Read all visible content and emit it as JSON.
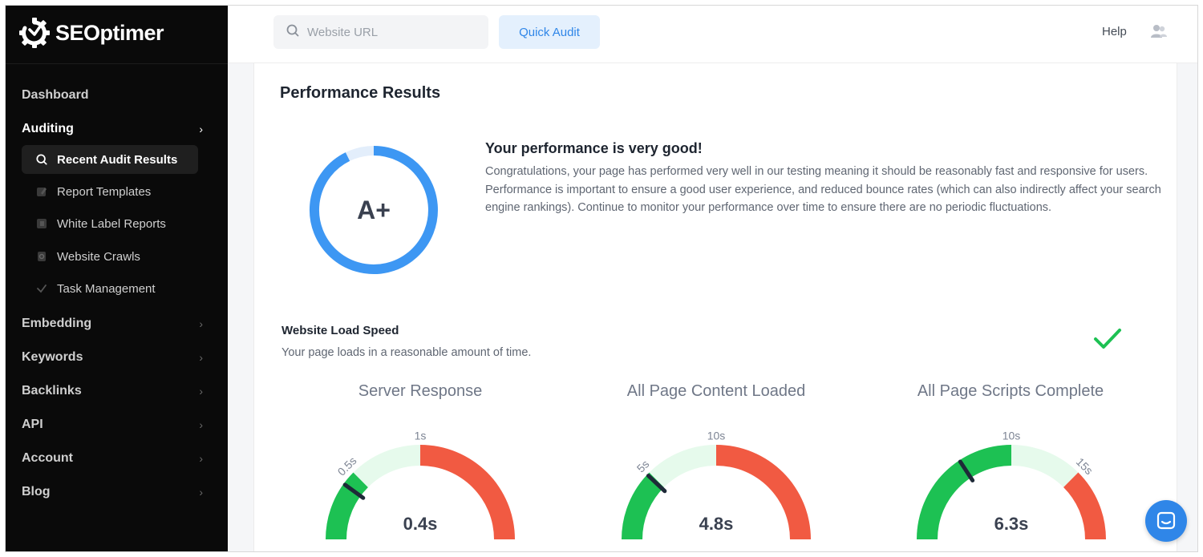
{
  "brand": {
    "name": "SEOptimer"
  },
  "sidebar": {
    "items": [
      {
        "label": "Dashboard"
      },
      {
        "label": "Auditing",
        "expanded": true
      },
      {
        "label": "Embedding"
      },
      {
        "label": "Keywords"
      },
      {
        "label": "Backlinks"
      },
      {
        "label": "API"
      },
      {
        "label": "Account"
      },
      {
        "label": "Blog"
      }
    ],
    "auditing_sub": [
      {
        "label": "Recent Audit Results",
        "icon": "search-icon",
        "selected": true
      },
      {
        "label": "Report Templates",
        "icon": "edit-icon"
      },
      {
        "label": "White Label Reports",
        "icon": "document-icon"
      },
      {
        "label": "Website Crawls",
        "icon": "crawl-icon"
      },
      {
        "label": "Task Management",
        "icon": "check-icon"
      }
    ]
  },
  "header": {
    "search_placeholder": "Website URL",
    "quick_audit_label": "Quick Audit",
    "help_label": "Help"
  },
  "performance": {
    "title": "Performance Results",
    "grade": "A+",
    "headline": "Your performance is very good!",
    "description": "Congratulations, your page has performed very well in our testing meaning it should be reasonably fast and responsive for users. Performance is important to ensure a good user experience, and reduced bounce rates (which can also indirectly affect your search engine rankings). Continue to monitor your performance over time to ensure there are no periodic fluctuations."
  },
  "load_speed": {
    "title": "Website Load Speed",
    "subtitle": "Your page loads in a reasonable amount of time."
  },
  "gauges": [
    {
      "title": "Server Response",
      "value_label": "0.4s",
      "value": 0.4,
      "max": 2,
      "green_to": 0.5,
      "lightgreen_to": 1,
      "ticks": [
        "0.5s",
        "1s"
      ],
      "tick_values": [
        0.5,
        1
      ]
    },
    {
      "title": "All Page Content Loaded",
      "value_label": "4.8s",
      "value": 4.8,
      "max": 20,
      "green_to": 5,
      "lightgreen_to": 10,
      "ticks": [
        "5s",
        "10s"
      ],
      "tick_values": [
        5,
        10
      ]
    },
    {
      "title": "All Page Scripts Complete",
      "value_label": "6.3s",
      "value": 6.3,
      "max": 20,
      "green_to": 10,
      "lightgreen_to": 15,
      "ticks": [
        "10s",
        "15s"
      ],
      "tick_values": [
        10,
        15
      ]
    }
  ],
  "colors": {
    "green": "#1dc153",
    "light_green": "#e6faec",
    "red": "#f15a42",
    "needle": "#1e2a38",
    "accent_blue": "#3d97f3"
  }
}
